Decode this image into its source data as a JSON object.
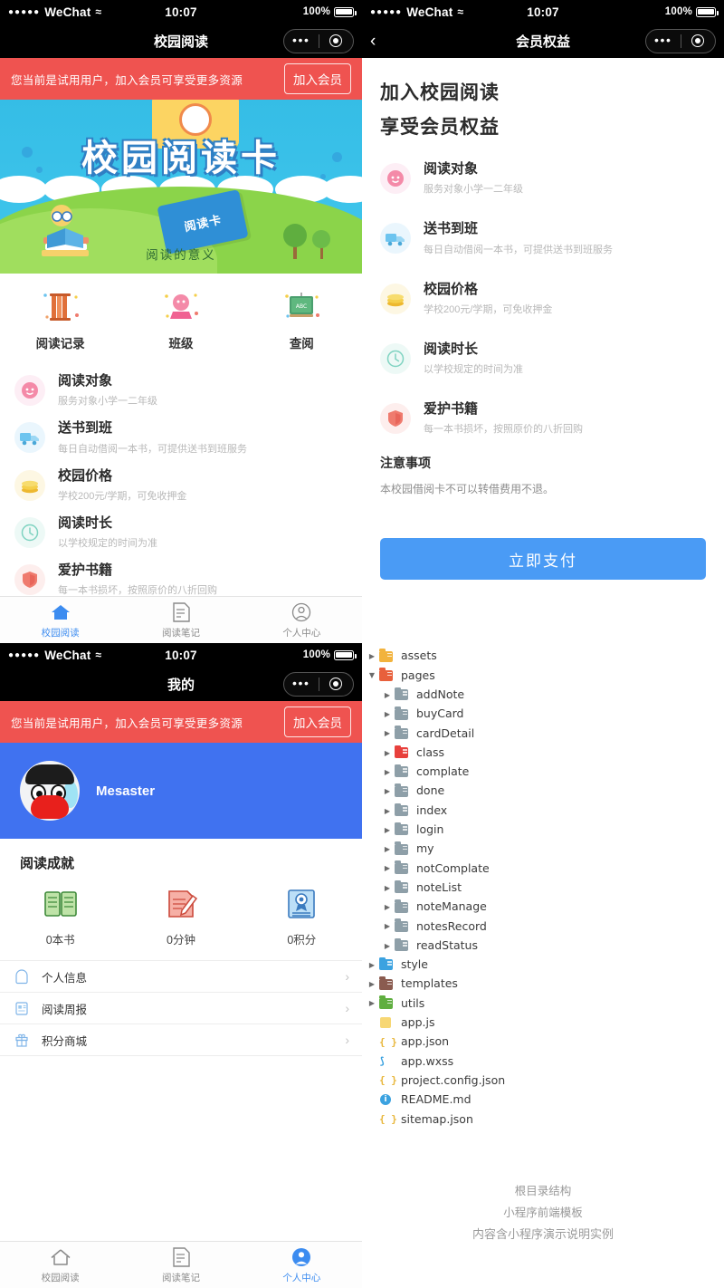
{
  "status_bar": {
    "carrier": "WeChat",
    "dots": "●●●●●",
    "wifi": "≈",
    "time": "10:07",
    "battery": "100%"
  },
  "home": {
    "nav_title": "校园阅读",
    "trial": {
      "text": "您当前是试用用户，加入会员可享受更多资源",
      "button": "加入会员"
    },
    "hero": {
      "title": "校园阅读卡",
      "card": "阅读卡",
      "subtitle": "阅读的意义"
    },
    "quick_menu": [
      {
        "label": "阅读记录",
        "icon": "books-icon"
      },
      {
        "label": "班级",
        "icon": "kid-icon"
      },
      {
        "label": "查阅",
        "icon": "blackboard-icon"
      }
    ],
    "features": [
      {
        "title": "阅读对象",
        "desc": "服务对象小学一二年级",
        "icon": "baby-face-icon",
        "color": "#f7a8c9",
        "bg": "#fdeef5"
      },
      {
        "title": "送书到班",
        "desc": "每日自动借阅一本书，可提供送书到班服务",
        "icon": "truck-icon",
        "color": "#6cc4ef",
        "bg": "#eaf6fd"
      },
      {
        "title": "校园价格",
        "desc": "学校200元/学期，可免收押金",
        "icon": "coins-icon",
        "color": "#f5cf4a",
        "bg": "#fdf7e3"
      },
      {
        "title": "阅读时长",
        "desc": "以学校规定的时间为准",
        "icon": "clock-icon",
        "color": "#7fd3c1",
        "bg": "#edf9f6"
      },
      {
        "title": "爱护书籍",
        "desc": "每一本书损坏，按照原价的八折回购",
        "icon": "shield-icon",
        "color": "#ef7b6e",
        "bg": "#fdeeed"
      }
    ],
    "tabbar": [
      {
        "label": "校园阅读",
        "icon": "home-icon",
        "active": true
      },
      {
        "label": "阅读笔记",
        "icon": "note-icon",
        "active": false
      },
      {
        "label": "个人中心",
        "icon": "user-icon",
        "active": false
      }
    ]
  },
  "member": {
    "nav_title": "会员权益",
    "back_icon": "chevron-left-icon",
    "heading_line1": "加入校园阅读",
    "heading_line2": "享受会员权益",
    "features": [
      {
        "title": "阅读对象",
        "desc": "服务对象小学一二年级",
        "icon": "baby-face-icon",
        "color": "#f7a8c9",
        "bg": "#fdeef5"
      },
      {
        "title": "送书到班",
        "desc": "每日自动借阅一本书，可提供送书到班服务",
        "icon": "truck-icon",
        "color": "#6cc4ef",
        "bg": "#eaf6fd"
      },
      {
        "title": "校园价格",
        "desc": "学校200元/学期，可免收押金",
        "icon": "coins-icon",
        "color": "#f5cf4a",
        "bg": "#fdf7e3"
      },
      {
        "title": "阅读时长",
        "desc": "以学校规定的时间为准",
        "icon": "clock-icon",
        "color": "#7fd3c1",
        "bg": "#edf9f6"
      },
      {
        "title": "爱护书籍",
        "desc": "每一本书损坏，按照原价的八折回购",
        "icon": "shield-icon",
        "color": "#ef7b6e",
        "bg": "#fdeeed"
      }
    ],
    "notes_title": "注意事项",
    "notes_text": "本校园借阅卡不可以转借费用不退。",
    "pay_button": "立即支付"
  },
  "mine": {
    "nav_title": "我的",
    "trial": {
      "text": "您当前是试用用户，加入会员可享受更多资源",
      "button": "加入会员"
    },
    "user_name": "Mesaster",
    "achievement_title": "阅读成就",
    "achievements": [
      {
        "label": "0本书",
        "icon": "open-book-icon"
      },
      {
        "label": "0分钟",
        "icon": "note-pen-icon"
      },
      {
        "label": "0积分",
        "icon": "medal-icon"
      }
    ],
    "list": [
      {
        "label": "个人信息",
        "icon": "profile-icon",
        "arrow": "›"
      },
      {
        "label": "阅读周报",
        "icon": "report-icon",
        "arrow": "›"
      },
      {
        "label": "积分商城",
        "icon": "gift-icon",
        "arrow": "›"
      }
    ],
    "tabbar": [
      {
        "label": "校园阅读",
        "icon": "home-icon",
        "active": false
      },
      {
        "label": "阅读笔记",
        "icon": "note-icon",
        "active": false
      },
      {
        "label": "个人中心",
        "icon": "user-icon",
        "active": true
      }
    ]
  },
  "tree": {
    "items": [
      {
        "label": "assets",
        "kind": "folder",
        "color": "#f2b33d",
        "indent": 0,
        "twisty": "right"
      },
      {
        "label": "pages",
        "kind": "folder",
        "color": "#e8603c",
        "indent": 0,
        "twisty": "down"
      },
      {
        "label": "addNote",
        "kind": "folder",
        "color": "#8e9fa8",
        "indent": 1,
        "twisty": "right"
      },
      {
        "label": "buyCard",
        "kind": "folder",
        "color": "#8e9fa8",
        "indent": 1,
        "twisty": "right"
      },
      {
        "label": "cardDetail",
        "kind": "folder",
        "color": "#8e9fa8",
        "indent": 1,
        "twisty": "right"
      },
      {
        "label": "class",
        "kind": "folder",
        "color": "#e8403c",
        "indent": 1,
        "twisty": "right"
      },
      {
        "label": "complate",
        "kind": "folder",
        "color": "#8e9fa8",
        "indent": 1,
        "twisty": "right"
      },
      {
        "label": "done",
        "kind": "folder",
        "color": "#8e9fa8",
        "indent": 1,
        "twisty": "right"
      },
      {
        "label": "index",
        "kind": "folder",
        "color": "#8e9fa8",
        "indent": 1,
        "twisty": "right"
      },
      {
        "label": "login",
        "kind": "folder",
        "color": "#8e9fa8",
        "indent": 1,
        "twisty": "right"
      },
      {
        "label": "my",
        "kind": "folder",
        "color": "#8e9fa8",
        "indent": 1,
        "twisty": "right"
      },
      {
        "label": "notComplate",
        "kind": "folder",
        "color": "#8e9fa8",
        "indent": 1,
        "twisty": "right"
      },
      {
        "label": "noteList",
        "kind": "folder",
        "color": "#8e9fa8",
        "indent": 1,
        "twisty": "right"
      },
      {
        "label": "noteManage",
        "kind": "folder",
        "color": "#8e9fa8",
        "indent": 1,
        "twisty": "right"
      },
      {
        "label": "notesRecord",
        "kind": "folder",
        "color": "#8e9fa8",
        "indent": 1,
        "twisty": "right"
      },
      {
        "label": "readStatus",
        "kind": "folder",
        "color": "#8e9fa8",
        "indent": 1,
        "twisty": "right"
      },
      {
        "label": "style",
        "kind": "folder",
        "color": "#3ba2e0",
        "indent": 0,
        "twisty": "right"
      },
      {
        "label": "templates",
        "kind": "folder",
        "color": "#8a5b4f",
        "indent": 0,
        "twisty": "right"
      },
      {
        "label": "utils",
        "kind": "folder",
        "color": "#5fae3f",
        "indent": 0,
        "twisty": "right"
      },
      {
        "label": "app.js",
        "kind": "js",
        "color": "#f7d774",
        "indent": 0,
        "twisty": "none"
      },
      {
        "label": "app.json",
        "kind": "json",
        "color": "#e8b63a",
        "indent": 0,
        "twisty": "none"
      },
      {
        "label": "app.wxss",
        "kind": "css",
        "color": "#3ba2e0",
        "indent": 0,
        "twisty": "none"
      },
      {
        "label": "project.config.json",
        "kind": "json",
        "color": "#e8b63a",
        "indent": 0,
        "twisty": "none"
      },
      {
        "label": "README.md",
        "kind": "info",
        "color": "#3ba2e0",
        "indent": 0,
        "twisty": "none"
      },
      {
        "label": "sitemap.json",
        "kind": "json",
        "color": "#e8b63a",
        "indent": 0,
        "twisty": "none"
      }
    ],
    "caption": [
      "根目录结构",
      "小程序前端模板",
      "内容含小程序演示说明实例"
    ]
  },
  "colors": {
    "accent_blue": "#4a9bf5",
    "trial_red": "#ef5350",
    "profile_blue": "#4072f0",
    "tab_active": "#3c8cf0"
  }
}
